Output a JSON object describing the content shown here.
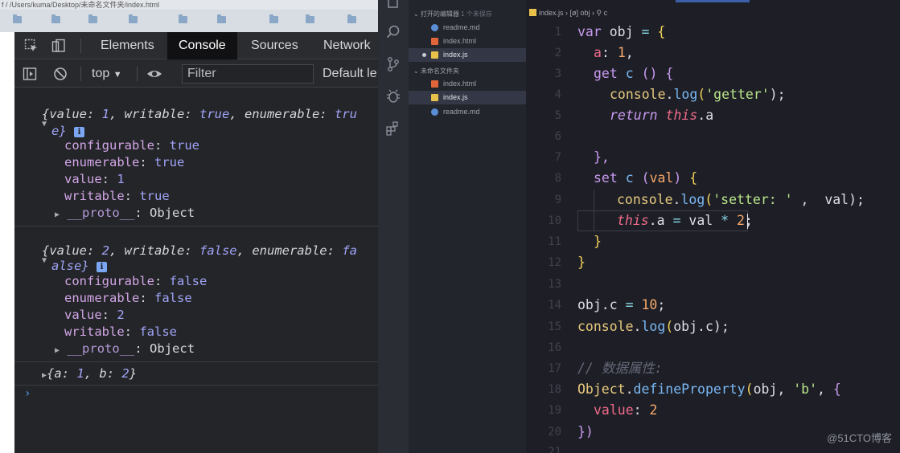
{
  "browser": {
    "address_text": "f / /Users/kuma/Desktop/未命名文件夹/index.html"
  },
  "devtools": {
    "tabs": [
      {
        "label": "Elements"
      },
      {
        "label": "Console"
      },
      {
        "label": "Sources"
      },
      {
        "label": "Network"
      }
    ],
    "active_tab": "Console",
    "toolbar": {
      "context": "top",
      "filter_placeholder": "Filter",
      "levels": "Default le"
    },
    "icons": {
      "inspect": "inspect-element-icon",
      "device": "device-toolbar-icon",
      "sidebar": "console-sidebar-icon",
      "clear": "clear-console-icon",
      "eye": "live-expression-icon"
    },
    "console": {
      "entry1": {
        "summary_a": "{value: ",
        "summary_v1": "1",
        "summary_b": ", writable: ",
        "summary_v2": "true",
        "summary_c": ", enumerable: ",
        "summary_v3": "tru",
        "wrap": "e}",
        "props": [
          {
            "key": "configurable",
            "value": "true"
          },
          {
            "key": "enumerable",
            "value": "true"
          },
          {
            "key": "value",
            "value": "1"
          },
          {
            "key": "writable",
            "value": "true"
          }
        ],
        "proto_key": "__proto__",
        "proto_value": "Object"
      },
      "entry2": {
        "summary_a": "{value: ",
        "summary_v1": "2",
        "summary_b": ", writable: ",
        "summary_v2": "false",
        "summary_c": ", enumerable: ",
        "summary_v3": "fa",
        "wrap": "alse}",
        "props": [
          {
            "key": "configurable",
            "value": "false"
          },
          {
            "key": "enumerable",
            "value": "false"
          },
          {
            "key": "value",
            "value": "2"
          },
          {
            "key": "writable",
            "value": "false"
          }
        ],
        "proto_key": "__proto__",
        "proto_value": "Object"
      },
      "entry3": {
        "a_open": "{a: ",
        "a_val": "1",
        "b_key": ", b: ",
        "b_val": "2",
        "close": "}"
      },
      "prompt": "›"
    }
  },
  "vscode": {
    "explorer": {
      "open_editors_label": "打开的编辑器",
      "open_editors_badge": "1 个未保存",
      "open_editors": [
        {
          "name": "readme.md",
          "type": "info"
        },
        {
          "name": "index.html",
          "type": "html"
        },
        {
          "name": "index.js",
          "type": "js",
          "modified": true
        }
      ],
      "folder_label": "未命名文件夹",
      "folder_files": [
        {
          "name": "index.html",
          "type": "html"
        },
        {
          "name": "index.js",
          "type": "js"
        },
        {
          "name": "readme.md",
          "type": "info"
        }
      ]
    },
    "breadcrumb": {
      "file": "index.js",
      "sep1": " › ",
      "sym1": "[ø] obj",
      "sep2": " › ",
      "sym2": "⚲ c"
    },
    "activity_icons": [
      "files-icon",
      "search-icon",
      "source-control-icon",
      "debug-icon",
      "extensions-icon"
    ],
    "code": {
      "line_numbers": [
        "1",
        "2",
        "3",
        "4",
        "5",
        "6",
        "7",
        "8",
        "9",
        "10",
        "11",
        "12",
        "13",
        "14",
        "15",
        "16",
        "17",
        "18",
        "19",
        "20",
        "21"
      ],
      "l1": {
        "kw": "var",
        "name": " obj ",
        "op": "=",
        "brace": " {"
      },
      "l2": {
        "prop": "a",
        "rest": ": ",
        "num": "1",
        "end": ","
      },
      "l3": {
        "kw": "get",
        "name": " c ",
        "paren": "()",
        "brace": " {"
      },
      "l4": {
        "obj": "console",
        "dot": ".",
        "fn": "log",
        "open": "(",
        "str": "'getter'",
        "close": ");"
      },
      "l5": {
        "kw": "return",
        "sp": " ",
        "th": "this",
        "rest": ".a"
      },
      "l7": {
        "text": "},"
      },
      "l8": {
        "kw": "set",
        "name": " c ",
        "open": "(",
        "param": "val",
        "close": ")",
        "brace": " {"
      },
      "l9": {
        "obj": "console",
        "dot": ".",
        "fn": "log",
        "open": "(",
        "str": "'setter: '",
        "mid": " ,  val",
        "close": ");"
      },
      "l10": {
        "th": "this",
        "rest": ".a ",
        "op": "=",
        "mid": " val ",
        "op2": "*",
        "sp": " ",
        "num": "2",
        "end": ";"
      },
      "l11": {
        "text": "}"
      },
      "l12": {
        "text": "}"
      },
      "l14": {
        "a": "obj.c ",
        "op": "=",
        "sp": " ",
        "num": "10",
        "end": ";"
      },
      "l15": {
        "obj": "console",
        "dot": ".",
        "fn": "log",
        "open": "(",
        "arg": "obj.c",
        "close": ");"
      },
      "l17": {
        "text": "// 数据属性:"
      },
      "l18": {
        "obj": "Object",
        "dot": ".",
        "fn": "defineProperty",
        "open": "(",
        "arg": "obj, ",
        "str": "'b'",
        "mid": ", ",
        "brace": "{"
      },
      "l19": {
        "prop": "value",
        "rest": ": ",
        "num": "2"
      },
      "l20": {
        "text": "})"
      }
    }
  },
  "watermark": "@51CTO博客"
}
